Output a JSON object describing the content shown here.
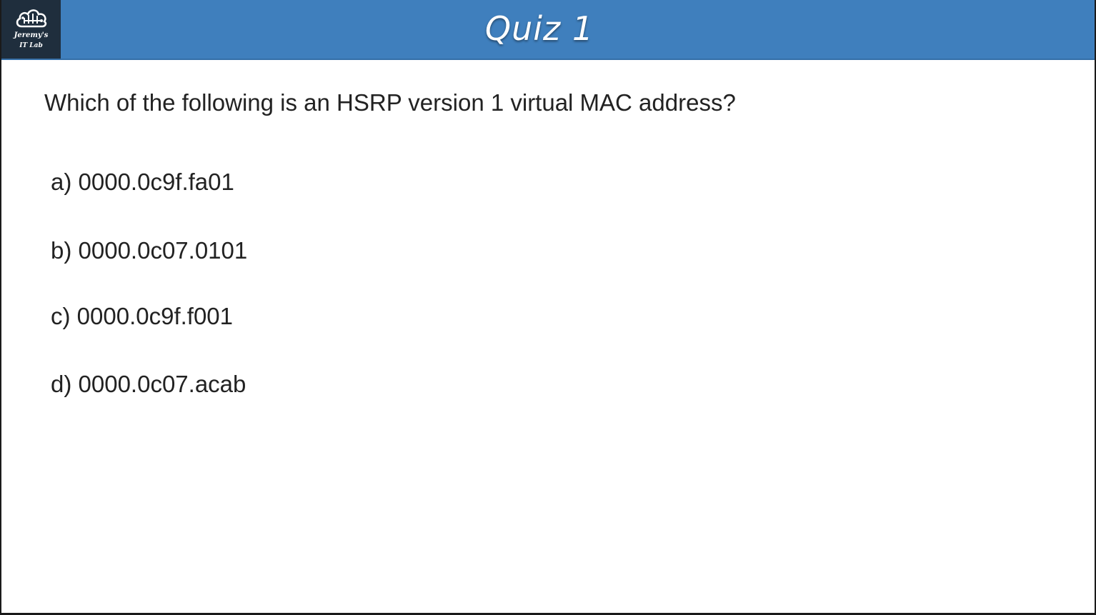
{
  "logo": {
    "line1": "Jeremy's",
    "line2": "IT Lab",
    "icon": "cloud-circuit-icon"
  },
  "header": {
    "title": "Quiz 1"
  },
  "quiz": {
    "question": "Which of the following is an HSRP version 1 virtual MAC address?",
    "options": [
      {
        "text": "a) 0000.0c9f.fa01"
      },
      {
        "text": "b) 0000.0c07.0101"
      },
      {
        "text": "c) 0000.0c9f.f001"
      },
      {
        "text": "d) 0000.0c07.acab"
      }
    ]
  },
  "colors": {
    "header_bg": "#3f7fbd",
    "logo_bg": "#1f2e3d",
    "text": "#222222",
    "slide_bg": "#ffffff"
  }
}
